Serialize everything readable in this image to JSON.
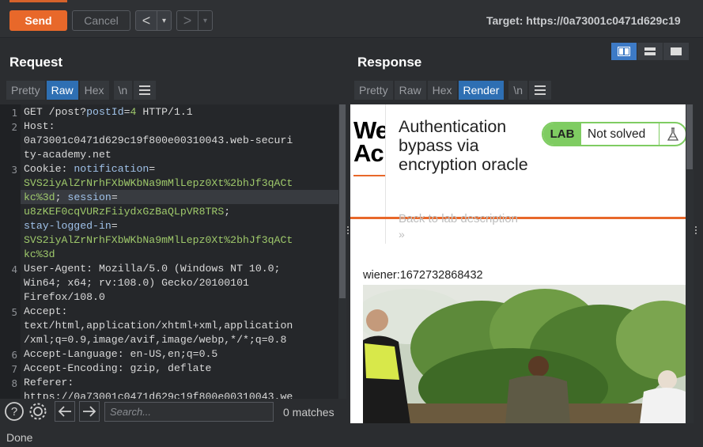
{
  "toolbar": {
    "send_label": "Send",
    "cancel_label": "Cancel",
    "back_arrow": "<",
    "forward_arrow": ">",
    "dropdown_glyph": "▾",
    "target_text": "Target: https://0a73001c0471d629c19"
  },
  "request": {
    "title": "Request",
    "tabs": [
      "Pretty",
      "Raw",
      "Hex",
      "\\n"
    ],
    "active_tab": "Raw",
    "line_numbers": [
      "1",
      "2",
      "3",
      "4",
      "5",
      "6",
      "7",
      "8"
    ],
    "lines": {
      "l1": {
        "method": "GET ",
        "path": "/post?",
        "pname": "postId",
        "eq": "=",
        "pval": "4",
        "proto": " HTTP/1.1"
      },
      "l2a": "Host: ",
      "l2b": "0a73001c0471d629c19f800e00310043.web-securi",
      "l2c": "ty-academy.net",
      "l3a": "Cookie: ",
      "l3k1": "notification",
      "l3eq": "=",
      "l3v1a": "SVS2iyAlZrNrhFXbWKbNa9mMlLepz0Xt%2bhJf3qACt",
      "l3v1b": "kc%3d",
      "l3sep": "; ",
      "l3k2": "session",
      "l3v2": "u8zKEF0cqVURzFiiydxGzBaQLpVR8TRS",
      "l3sep2": ";",
      "l3k3": "stay-logged-in",
      "l3v3a": "SVS2iyAlZrNrhFXbWKbNa9mMlLepz0Xt%2bhJf3qACt",
      "l3v3b": "kc%3d",
      "l4a": "User-Agent: ",
      "l4b": "Mozilla/5.0 (Windows NT 10.0;",
      "l4c": "Win64; x64; rv:108.0) Gecko/20100101",
      "l4d": "Firefox/108.0",
      "l5a": "Accept: ",
      "l5b": "text/html,application/xhtml+xml,application",
      "l5c": "/xml;q=0.9,image/avif,image/webp,*/*;q=0.8",
      "l6a": "Accept-Language: ",
      "l6b": "en-US,en;q=0.5",
      "l7a": "Accept-Encoding: ",
      "l7b": "gzip, deflate",
      "l8a": "Referer: ",
      "l8b": "https://0a73001c0471d629c19f800e00310043.we"
    },
    "search_placeholder": "Search...",
    "matches": "0 matches"
  },
  "response": {
    "title": "Response",
    "tabs": [
      "Pretty",
      "Raw",
      "Hex",
      "Render",
      "\\n"
    ],
    "active_tab": "Render",
    "render": {
      "logo_text_1": "We",
      "logo_text_2": "Ac",
      "lab_title": "Authentication bypass via encryption oracle",
      "badge_lab": "LAB",
      "badge_status": "Not solved",
      "back_link": "Back to lab description",
      "back_chevron": "»",
      "user_line": "wiener:1672732868432"
    }
  },
  "status_bar": {
    "text": "Done"
  },
  "icons": [
    "help-icon",
    "settings-gear-icon",
    "back-arrow-icon",
    "forward-arrow-icon",
    "menu-icon",
    "flask-icon",
    "layout-split-icon",
    "layout-horizontal-icon",
    "layout-single-icon"
  ],
  "colors": {
    "accent": "#e8682a",
    "active_tab": "#2e6fb3",
    "lab_green": "#7fcc62"
  }
}
